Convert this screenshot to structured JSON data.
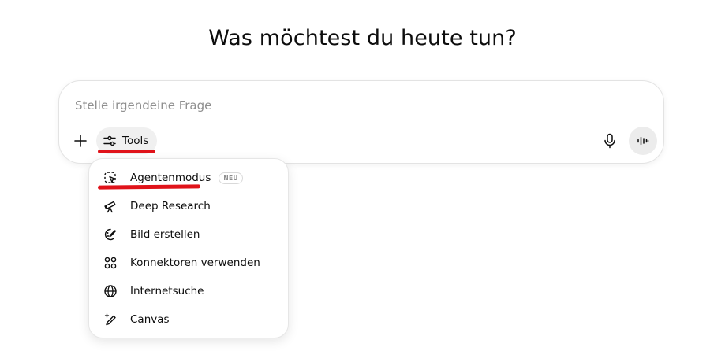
{
  "heading": "Was möchtest du heute tun?",
  "composer": {
    "placeholder": "Stelle irgendeine Frage",
    "value": "",
    "tools_label": "Tools"
  },
  "icons": {
    "plus": "plus-icon",
    "tools": "sliders-icon",
    "microphone": "microphone-icon",
    "voice": "voice-waveform-icon"
  },
  "menu": {
    "items": [
      {
        "label": "Agentenmodus",
        "icon": "agent-cursor-icon",
        "badge": "NEU"
      },
      {
        "label": "Deep Research",
        "icon": "telescope-icon"
      },
      {
        "label": "Bild erstellen",
        "icon": "image-palette-icon"
      },
      {
        "label": "Konnektoren verwenden",
        "icon": "connectors-icon"
      },
      {
        "label": "Internetsuche",
        "icon": "globe-icon"
      },
      {
        "label": "Canvas",
        "icon": "pen-sparkle-icon"
      }
    ]
  },
  "colors": {
    "annotation": "#e0131a",
    "tools_bg": "#f0f0f0",
    "voice_bg": "#ececec"
  }
}
